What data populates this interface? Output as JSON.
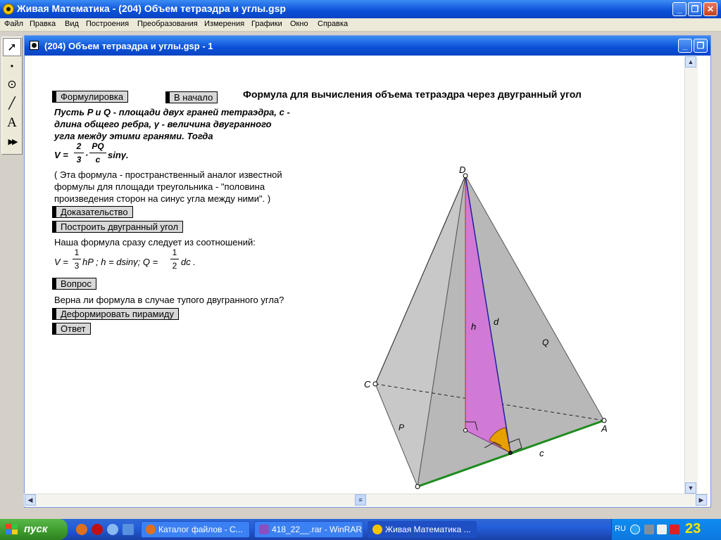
{
  "app": {
    "title": "Живая Математика - (204) Объем тетраэдра и углы.gsp",
    "window_buttons": {
      "min": "_",
      "max": "❐",
      "close": "✕"
    }
  },
  "menu": [
    "Файл",
    "Правка",
    "Вид",
    "Построения",
    "Преобразования",
    "Измерения",
    "Графики",
    "Окно",
    "Справка"
  ],
  "toolbox": [
    {
      "name": "arrow-tool-icon",
      "glyph": "➚"
    },
    {
      "name": "point-tool-icon",
      "glyph": "•"
    },
    {
      "name": "compass-tool-icon",
      "glyph": "⊙"
    },
    {
      "name": "straightedge-tool-icon",
      "glyph": "╱"
    },
    {
      "name": "text-tool-icon",
      "glyph": "A"
    },
    {
      "name": "custom-tool-icon",
      "glyph": "▶▶"
    }
  ],
  "document": {
    "title": "(204) Объем тетраэдра и углы.gsp - 1",
    "heading": "Формула для вычисления объема тетраэдра через двугранный угол",
    "buttons": {
      "formulation": "Формулировка",
      "to_start": "В начало",
      "proof": "Доказательство",
      "build_angle": "Построить двугранный угол",
      "question": "Вопрос",
      "deform": "Деформировать пирамиду",
      "answer": "Ответ"
    },
    "statement": [
      "Пусть P и Q - площади двух граней тетраэдра, c -",
      "длина общего ребра, γ - величина двугранного",
      "угла между этими гранями. Тогда"
    ],
    "formula_main": {
      "lhs": "V =",
      "n1": "2",
      "d1": "3",
      "dot": "·",
      "n2": "PQ",
      "d2": "c",
      "tail": "sinγ."
    },
    "remark": [
      "( Эта формула - пространственный аналог известной",
      "формулы для площади треугольника - \"половина",
      "произведения сторон на синус угла между ними\". )"
    ],
    "proof_intro": "Наша формула сразу следует из соотношений:",
    "formula_rel": {
      "lhs": "V =",
      "n1": "1",
      "d1": "3",
      "mid": "hP ; h = dsinγ; Q =",
      "n2": "1",
      "d2": "2",
      "tail": "dc ."
    },
    "question_text": "Верна ли формула в случае тупого двугранного угла?"
  },
  "figure": {
    "labels": {
      "D": "D",
      "C": "C",
      "A": "A",
      "P": "P",
      "Q": "Q",
      "h": "h",
      "d": "d",
      "c": "c"
    },
    "colors": {
      "face": "#c8c8c8",
      "face_dark": "#b4b4b4",
      "pink": "#d07ad6",
      "edge_c": "#1e8c1e",
      "angle": "#e8a000",
      "height": "#e03030",
      "d_line": "#2020a0"
    }
  },
  "taskbar": {
    "start": "пуск",
    "items": [
      "Каталог файлов - С...",
      "418_22__.rar - WinRAR",
      "Живая Математика ..."
    ],
    "lang": "RU",
    "clock": "23"
  }
}
